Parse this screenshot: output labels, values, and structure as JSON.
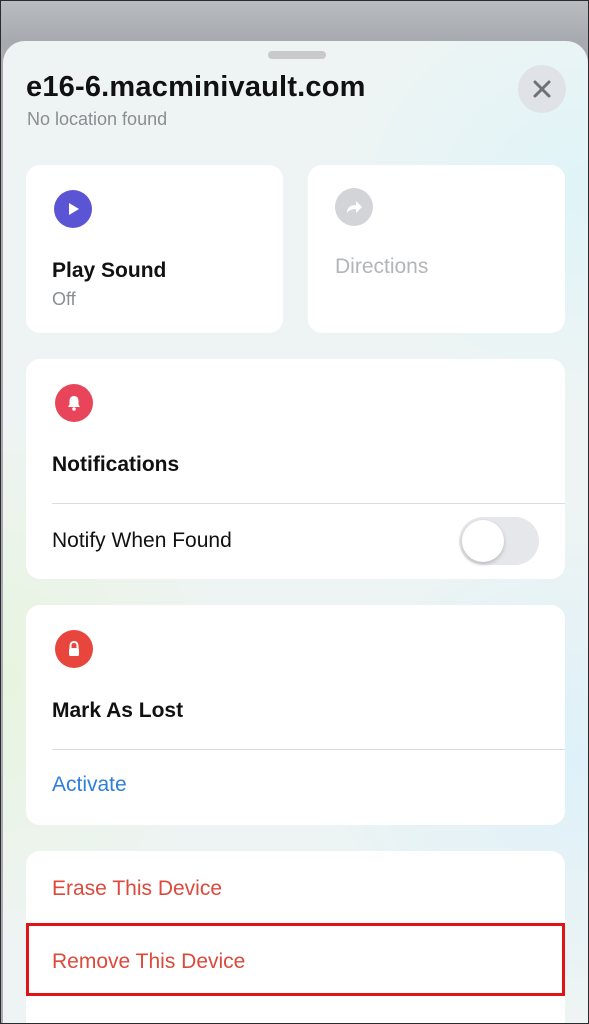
{
  "header": {
    "title": "e16-6.macminivault.com",
    "subtitle": "No location found"
  },
  "actions": {
    "play_sound": {
      "title": "Play Sound",
      "status": "Off"
    },
    "directions": {
      "title": "Directions"
    }
  },
  "notifications": {
    "title": "Notifications",
    "notify_label": "Notify When Found",
    "notify_enabled": false
  },
  "lost_mode": {
    "title": "Mark As Lost",
    "action": "Activate"
  },
  "device": {
    "erase": "Erase This Device",
    "remove": "Remove This Device"
  },
  "colors": {
    "play_icon": "#5b55d6",
    "directions_icon": "#d2d4d8",
    "notification_icon": "#e8455a",
    "lock_icon": "#e8453c",
    "link_blue": "#2f7fd9",
    "destructive_red": "#dc4a3c",
    "highlight_border": "#e01414"
  },
  "icons": {
    "play": "play-icon",
    "directions": "directions-arrow-icon",
    "bell": "bell-icon",
    "lock": "lock-icon",
    "close": "close-icon"
  }
}
